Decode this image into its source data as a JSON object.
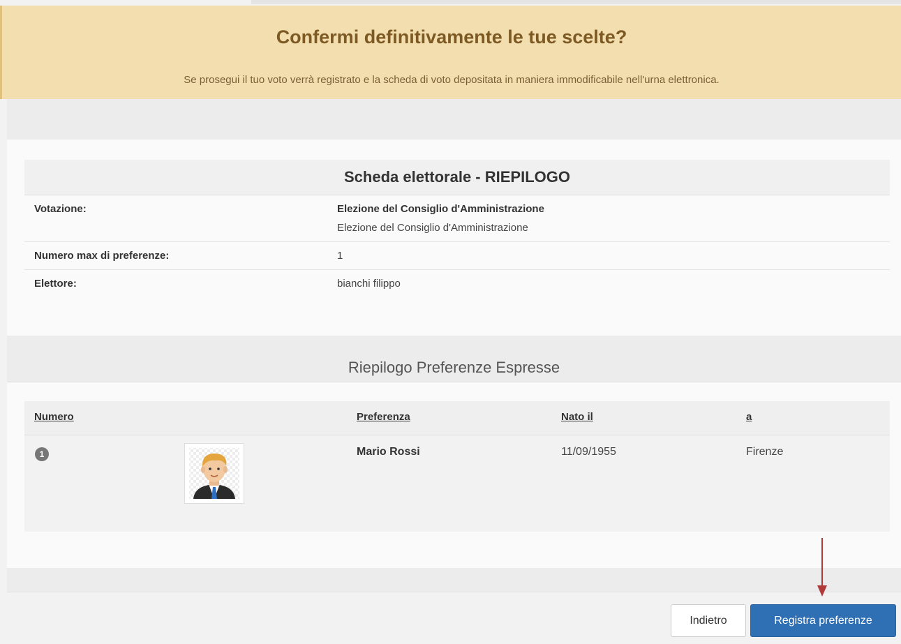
{
  "banner": {
    "title": "Confermi definitivamente le tue scelte?",
    "subtitle": "Se prosegui il tuo voto verrà registrato e la scheda di voto depositata in maniera immodificabile nell'urna elettronica."
  },
  "summary": {
    "heading": "Scheda elettorale - RIEPILOGO",
    "rows": [
      {
        "label": "Votazione:",
        "value": "Elezione del Consiglio d'Amministrazione",
        "detail": "Elezione del Consiglio d'Amministrazione"
      },
      {
        "label": "Numero max di preferenze:",
        "value": "1"
      },
      {
        "label": "Elettore:",
        "value": "bianchi filippo"
      }
    ]
  },
  "preferences": {
    "section_title": "Riepilogo Preferenze Espresse",
    "columns": [
      "Numero",
      "Preferenza",
      "Nato il",
      "a"
    ],
    "rows": [
      {
        "number": "1",
        "name": "Mario Rossi",
        "born": "11/09/1955",
        "place": "Firenze",
        "photo_icon": "candidate-avatar-icon"
      }
    ]
  },
  "actions": {
    "back_label": "Indietro",
    "submit_label": "Registra preferenze"
  },
  "colors": {
    "banner_bg": "#f3deb0",
    "banner_title": "#7d5a23",
    "primary_button": "#2f6fb3",
    "arrow": "#b03a3a"
  }
}
